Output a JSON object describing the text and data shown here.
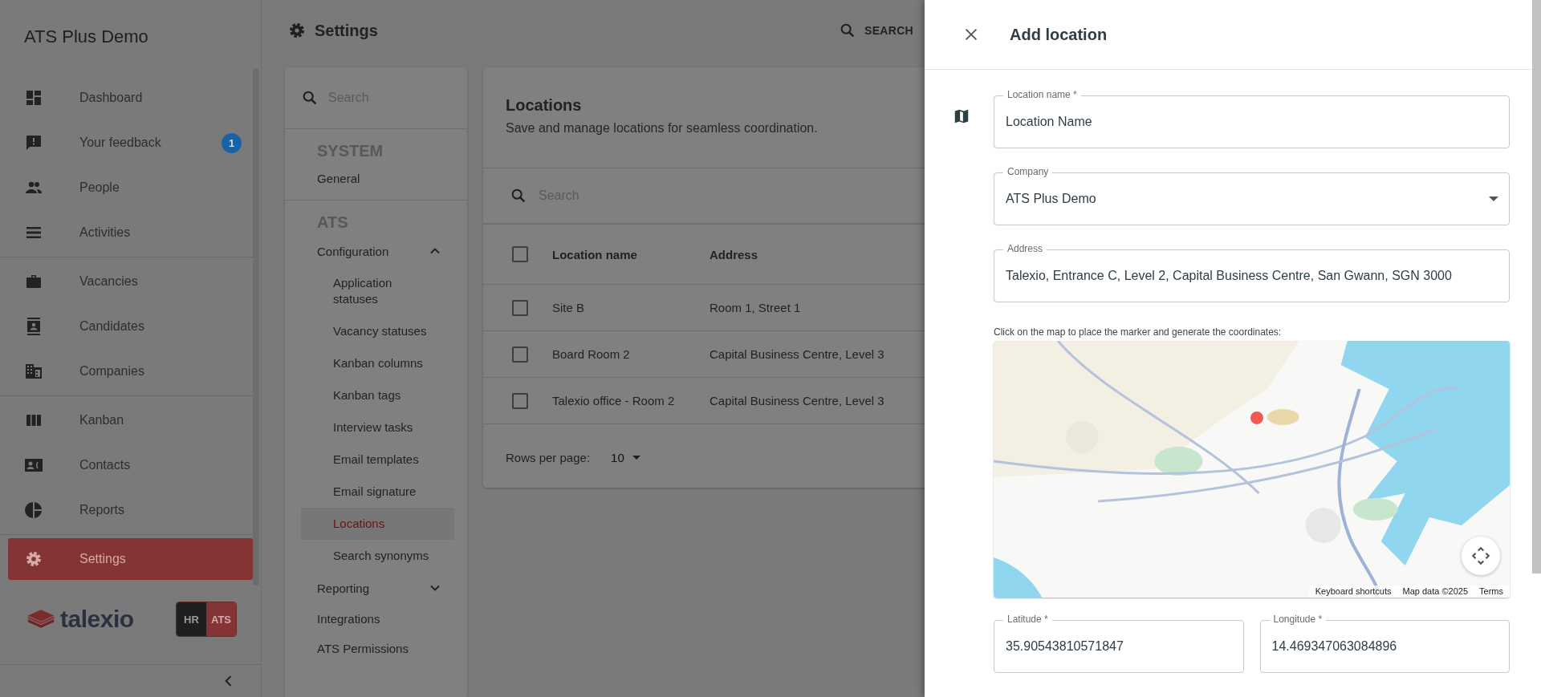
{
  "sidebar": {
    "title": "ATS Plus Demo",
    "groups": [
      [
        {
          "label": "Dashboard",
          "selected": false
        },
        {
          "label": "Your feedback",
          "selected": false,
          "badge": "1"
        },
        {
          "label": "People",
          "selected": false
        },
        {
          "label": "Activities",
          "selected": false
        }
      ],
      [
        {
          "label": "Vacancies",
          "selected": false
        },
        {
          "label": "Candidates",
          "selected": false
        },
        {
          "label": "Companies",
          "selected": false
        }
      ],
      [
        {
          "label": "Kanban",
          "selected": false
        },
        {
          "label": "Contacts",
          "selected": false
        },
        {
          "label": "Reports",
          "selected": false
        }
      ],
      [
        {
          "label": "Settings",
          "selected": true
        }
      ]
    ],
    "brand": "talexio",
    "switch": [
      {
        "label": "HR",
        "selected": false
      },
      {
        "label": "ATS",
        "selected": true
      }
    ]
  },
  "header": {
    "title": "Settings",
    "search_button": "SEARCH"
  },
  "settings_nav": {
    "search": {
      "placeholder": "Search"
    },
    "groups": [
      {
        "heading": "SYSTEM",
        "items": [
          {
            "label": "General",
            "selected": false
          }
        ]
      },
      {
        "heading": "ATS",
        "items": [
          {
            "label": "Configuration",
            "selected": false,
            "expanded": true,
            "children": [
              {
                "label": "Application statuses",
                "selected": false
              },
              {
                "label": "Vacancy statuses",
                "selected": false
              },
              {
                "label": "Kanban columns",
                "selected": false
              },
              {
                "label": "Kanban tags",
                "selected": false
              },
              {
                "label": "Interview tasks",
                "selected": false
              },
              {
                "label": "Email templates",
                "selected": false
              },
              {
                "label": "Email signature",
                "selected": false
              },
              {
                "label": "Locations",
                "selected": true
              },
              {
                "label": "Search synonyms",
                "selected": false
              }
            ]
          },
          {
            "label": "Reporting",
            "selected": false,
            "expanded": false
          },
          {
            "label": "Integrations",
            "selected": false
          },
          {
            "label": "ATS Permissions",
            "selected": false
          }
        ]
      }
    ]
  },
  "locations": {
    "title": "Locations",
    "subtitle": "Save and manage locations for seamless coordination.",
    "search": {
      "placeholder": "Search"
    },
    "table": {
      "all_checked": false,
      "columns": [
        "Location name",
        "Address"
      ],
      "rows": [
        {
          "checked": false,
          "cells": [
            "Site B",
            "Room 1, Street 1"
          ]
        },
        {
          "checked": false,
          "cells": [
            "Board Room 2",
            "Capital Business Centre, Level 3"
          ]
        },
        {
          "checked": false,
          "cells": [
            "Talexio office - Room 2",
            "Capital Business Centre, Level 3"
          ]
        }
      ]
    },
    "rows_per_page": {
      "label": "Rows per page:",
      "value": "10"
    }
  },
  "drawer": {
    "title": "Add location",
    "fields": [
      {
        "kind": "text",
        "label": "Location name *",
        "value": "Location Name"
      },
      {
        "kind": "select",
        "label": "Company",
        "value": "ATS Plus Demo"
      },
      {
        "kind": "text",
        "label": "Address",
        "value": "Talexio, Entrance C, Level 2, Capital Business Centre, San Gwann, SGN 3000"
      }
    ],
    "map": {
      "hint": "Click on the map to place the marker and generate the coordinates:",
      "attribution": [
        {
          "label": "Keyboard shortcuts"
        },
        {
          "label": "Map data ©2025"
        },
        {
          "label": "Terms"
        }
      ]
    },
    "coordinates": [
      {
        "label": "Latitude *",
        "value": "35.90543810571847"
      },
      {
        "label": "Longitude *",
        "value": "14.469347063084896"
      }
    ]
  }
}
